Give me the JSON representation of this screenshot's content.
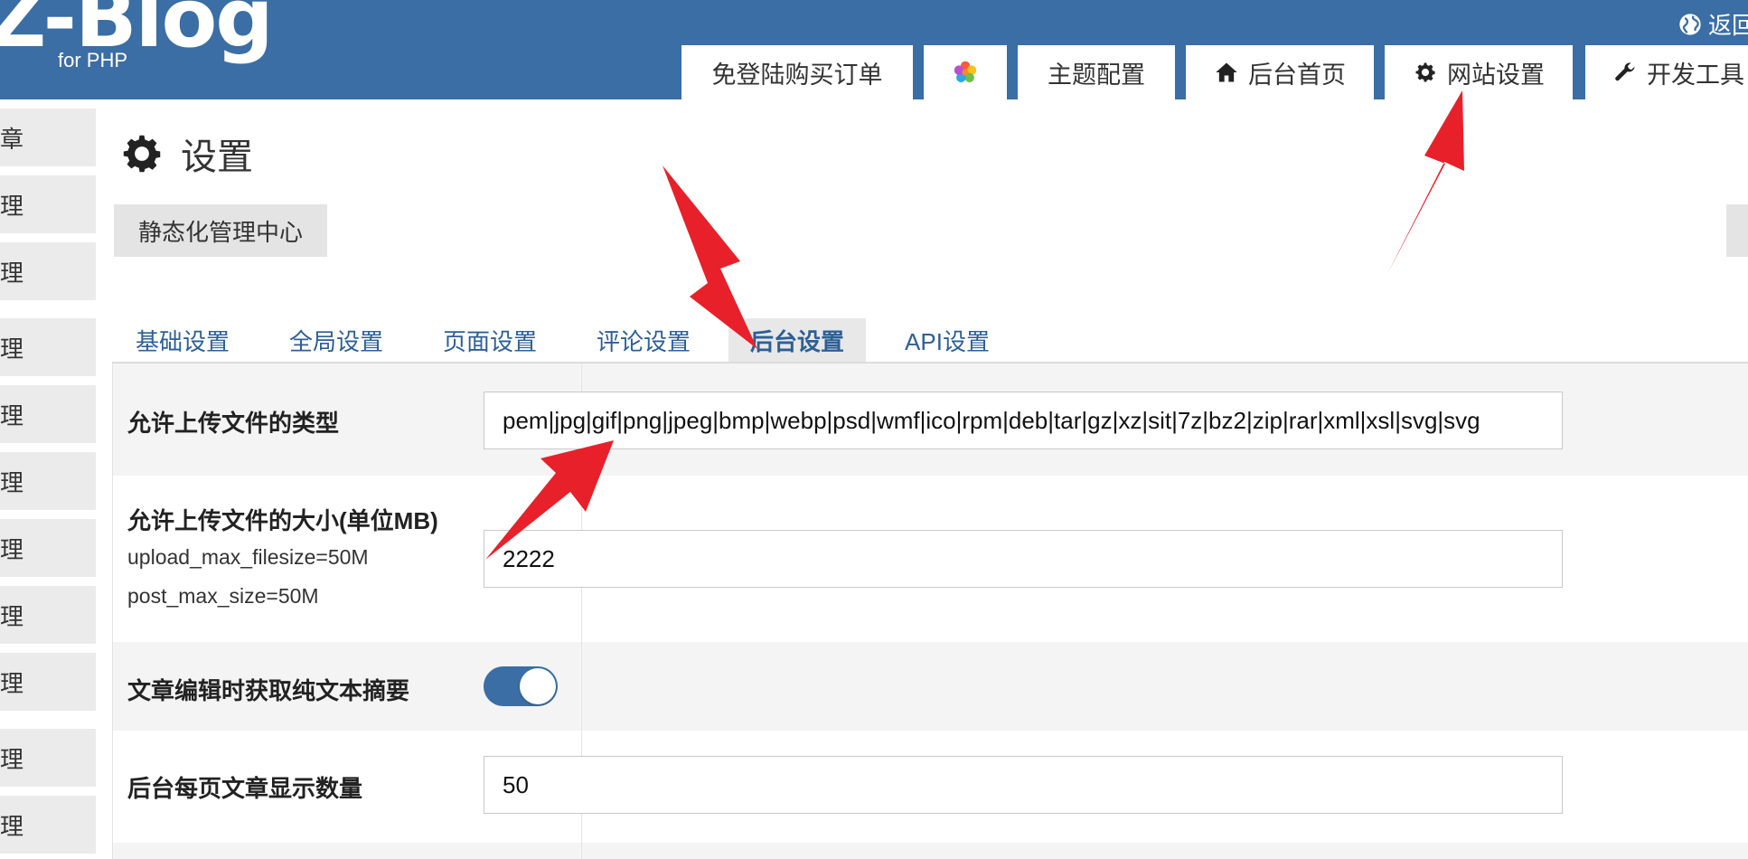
{
  "header": {
    "logo": "Z-Blog",
    "logo_sub": "for PHP",
    "top_link": "返回",
    "nav_tabs": [
      {
        "label": "免登陆购买订单",
        "icon": ""
      },
      {
        "label": "",
        "icon": "colorful-flower-icon"
      },
      {
        "label": "主题配置",
        "icon": ""
      },
      {
        "label": "后台首页",
        "icon": "home-icon"
      },
      {
        "label": "网站设置",
        "icon": "gear-icon"
      },
      {
        "label": "开发工具",
        "icon": "wrench-icon"
      }
    ]
  },
  "sidebar": {
    "items": [
      {
        "label": "章"
      },
      {
        "label": "理"
      },
      {
        "label": "理"
      },
      {
        "label": "理"
      },
      {
        "label": "理"
      },
      {
        "label": "理"
      },
      {
        "label": "理"
      },
      {
        "label": "理"
      },
      {
        "label": "理"
      },
      {
        "label": "理"
      },
      {
        "label": "理"
      }
    ]
  },
  "main": {
    "title": "设置",
    "sub_button": "静态化管理中心",
    "tabs": [
      {
        "label": "基础设置"
      },
      {
        "label": "全局设置"
      },
      {
        "label": "页面设置"
      },
      {
        "label": "评论设置"
      },
      {
        "label": "后台设置",
        "active": true
      },
      {
        "label": "API设置"
      }
    ],
    "rows": [
      {
        "label": "允许上传文件的类型",
        "type": "text",
        "value": "pem|jpg|gif|png|jpeg|bmp|webp|psd|wmf|ico|rpm|deb|tar|gz|xz|sit|7z|bz2|zip|rar|xml|xsl|svg|svg"
      },
      {
        "label": "允许上传文件的大小(单位MB)",
        "type": "text",
        "value": "2222",
        "notes": [
          "upload_max_filesize=50M",
          "post_max_size=50M"
        ]
      },
      {
        "label": "文章编辑时获取纯文本摘要",
        "type": "toggle",
        "on": true
      },
      {
        "label": "后台每页文章显示数量",
        "type": "text",
        "value": "50"
      }
    ]
  },
  "colors": {
    "header_bg": "#3a6ea5",
    "tab_text": "#2d5f97",
    "arrow": "#e8202a"
  }
}
